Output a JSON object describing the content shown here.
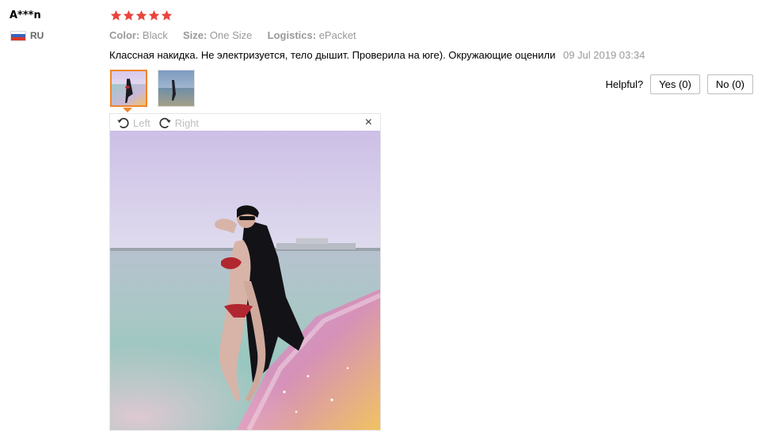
{
  "reviewer": {
    "name": "A***n",
    "country": "RU"
  },
  "rating": {
    "stars": 5,
    "color": "#e8453c"
  },
  "attributes": [
    {
      "key": "Color:",
      "value": "Black"
    },
    {
      "key": "Size:",
      "value": "One Size"
    },
    {
      "key": "Logistics:",
      "value": "ePacket"
    }
  ],
  "review": {
    "text": "Классная накидка. Не электризуется, тело дышит. Проверила на юге). Окружающие оценили",
    "date": "09 Jul 2019 03:34"
  },
  "helpful": {
    "label": "Helpful?",
    "yes": "Yes (0)",
    "no": "No (0)"
  },
  "viewer": {
    "left_label": "Left",
    "right_label": "Right",
    "close_glyph": "×"
  },
  "colors": {
    "accent": "#f0852c",
    "muted": "#999999"
  }
}
